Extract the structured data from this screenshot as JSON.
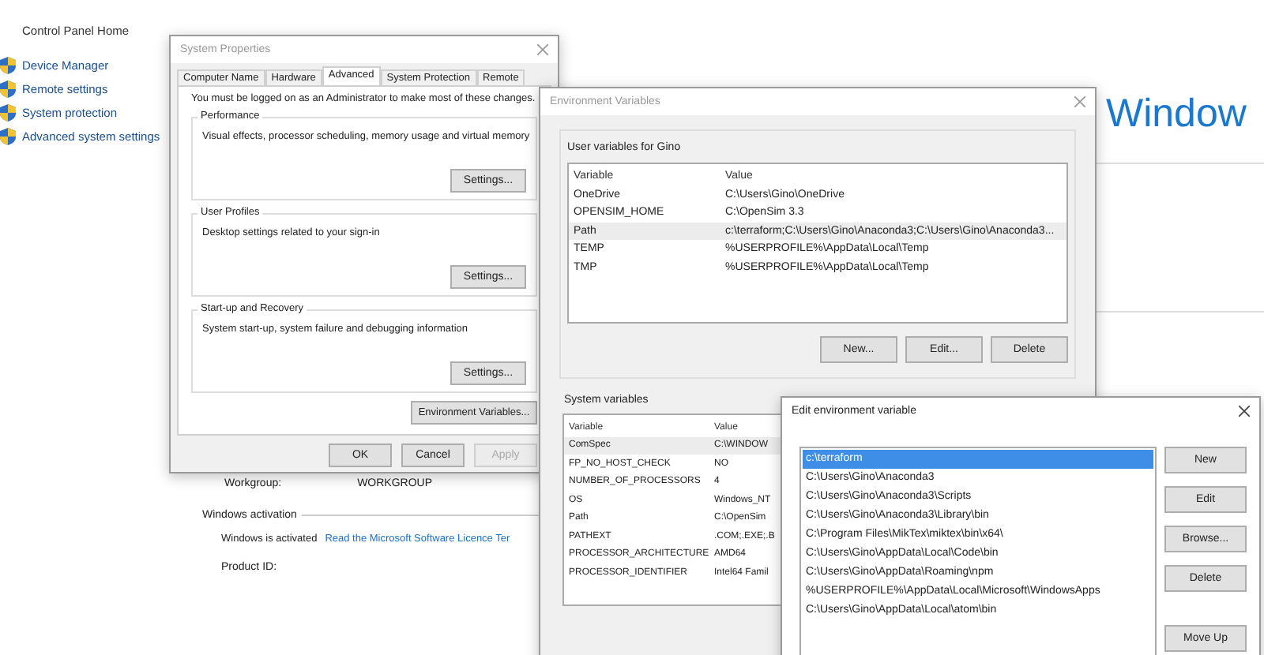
{
  "control_panel": {
    "home_link": "Control Panel Home",
    "sidebar_items": [
      {
        "label": "Device Manager"
      },
      {
        "label": "Remote settings"
      },
      {
        "label": "System protection"
      },
      {
        "label": "Advanced system settings"
      }
    ],
    "heading": "Window",
    "workgroup": {
      "label": "Workgroup:",
      "value": "WORKGROUP"
    },
    "activation": {
      "title": "Windows activation",
      "status": "Windows is activated",
      "link": "Read the Microsoft Software Licence Ter"
    },
    "product_id": {
      "label": "Product ID:"
    }
  },
  "system_properties": {
    "title": "System Properties",
    "tabs": [
      {
        "label": "Computer Name",
        "selected": false
      },
      {
        "label": "Hardware",
        "selected": false
      },
      {
        "label": "Advanced",
        "selected": true
      },
      {
        "label": "System Protection",
        "selected": false
      },
      {
        "label": "Remote",
        "selected": false
      }
    ],
    "notice": "You must be logged on as an Administrator to make most of these changes.",
    "groups": [
      {
        "title": "Performance",
        "description": "Visual effects, processor scheduling, memory usage and virtual memory",
        "button": "Settings..."
      },
      {
        "title": "User Profiles",
        "description": "Desktop settings related to your sign-in",
        "button": "Settings..."
      },
      {
        "title": "Start-up and Recovery",
        "description": "System start-up, system failure and debugging information",
        "button": "Settings..."
      }
    ],
    "env_button": "Environment Variables...",
    "buttons": [
      {
        "label": "OK",
        "disabled": false
      },
      {
        "label": "Cancel",
        "disabled": false
      },
      {
        "label": "Apply",
        "disabled": true
      }
    ]
  },
  "environment_variables": {
    "title": "Environment Variables",
    "user_section": {
      "title": "User variables for Gino",
      "columns": [
        "Variable",
        "Value"
      ],
      "rows": [
        {
          "variable": "OneDrive",
          "value": "C:\\Users\\Gino\\OneDrive",
          "selected": false
        },
        {
          "variable": "OPENSIM_HOME",
          "value": "C:\\OpenSim 3.3",
          "selected": false
        },
        {
          "variable": "Path",
          "value": "c:\\terraform;C:\\Users\\Gino\\Anaconda3;C:\\Users\\Gino\\Anaconda3...",
          "selected": true
        },
        {
          "variable": "TEMP",
          "value": "%USERPROFILE%\\AppData\\Local\\Temp",
          "selected": false
        },
        {
          "variable": "TMP",
          "value": "%USERPROFILE%\\AppData\\Local\\Temp",
          "selected": false
        }
      ],
      "buttons": [
        "New...",
        "Edit...",
        "Delete"
      ]
    },
    "system_section": {
      "title": "System variables",
      "columns": [
        "Variable",
        "Value"
      ],
      "rows": [
        {
          "variable": "ComSpec",
          "value": "C:\\WINDOW",
          "selected": true
        },
        {
          "variable": "FP_NO_HOST_CHECK",
          "value": "NO",
          "selected": false
        },
        {
          "variable": "NUMBER_OF_PROCESSORS",
          "value": "4",
          "selected": false
        },
        {
          "variable": "OS",
          "value": "Windows_NT",
          "selected": false
        },
        {
          "variable": "Path",
          "value": "C:\\OpenSim",
          "selected": false
        },
        {
          "variable": "PATHEXT",
          "value": ".COM;.EXE;.B",
          "selected": false
        },
        {
          "variable": "PROCESSOR_ARCHITECTURE",
          "value": "AMD64",
          "selected": false
        },
        {
          "variable": "PROCESSOR_IDENTIFIER",
          "value": "Intel64 Famil",
          "selected": false
        }
      ]
    }
  },
  "edit_dialog": {
    "title": "Edit environment variable",
    "entries": [
      {
        "text": "c:\\terraform",
        "selected": true
      },
      {
        "text": "C:\\Users\\Gino\\Anaconda3",
        "selected": false
      },
      {
        "text": "C:\\Users\\Gino\\Anaconda3\\Scripts",
        "selected": false
      },
      {
        "text": "C:\\Users\\Gino\\Anaconda3\\Library\\bin",
        "selected": false
      },
      {
        "text": "C:\\Program Files\\MikTex\\miktex\\bin\\x64\\",
        "selected": false
      },
      {
        "text": "C:\\Users\\Gino\\AppData\\Local\\Code\\bin",
        "selected": false
      },
      {
        "text": "C:\\Users\\Gino\\AppData\\Roaming\\npm",
        "selected": false
      },
      {
        "text": "%USERPROFILE%\\AppData\\Local\\Microsoft\\WindowsApps",
        "selected": false
      },
      {
        "text": "C:\\Users\\Gino\\AppData\\Local\\atom\\bin",
        "selected": false
      }
    ],
    "buttons": [
      "New",
      "Edit",
      "Browse...",
      "Delete",
      "Move Up"
    ]
  }
}
